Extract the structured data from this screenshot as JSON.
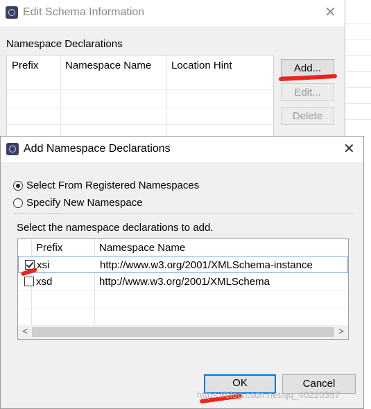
{
  "back_dialog": {
    "title": "Edit Schema Information",
    "close_glyph": "✕",
    "section_label": "Namespace Declarations",
    "columns": [
      "Prefix",
      "Namespace Name",
      "Location Hint"
    ],
    "buttons": {
      "add": "Add...",
      "edit": "Edit...",
      "delete": "Delete"
    }
  },
  "dialog": {
    "title": "Add Namespace Declarations",
    "close_glyph": "✕",
    "options": {
      "registered": "Select From Registered Namespaces",
      "new": "Specify New Namespace",
      "selected": "registered"
    },
    "list_label": "Select the namespace declarations to add.",
    "columns": [
      "Prefix",
      "Namespace Name"
    ],
    "rows": [
      {
        "prefix": "xsi",
        "namespace": "http://www.w3.org/2001/XMLSchema-instance",
        "checked": true
      },
      {
        "prefix": "xsd",
        "namespace": "http://www.w3.org/2001/XMLSchema",
        "checked": false
      }
    ],
    "scroll": {
      "left": "<",
      "right": ">"
    },
    "buttons": {
      "ok": "OK",
      "cancel": "Cancel"
    }
  },
  "watermark": "https://blog.csdn.net/qq_40220357",
  "colors": {
    "annotation": "#e8261c",
    "focus": "#0078d7"
  },
  "icons": [
    "app-icon",
    "close-icon",
    "scroll-left-arrow-icon",
    "scroll-right-arrow-icon"
  ]
}
